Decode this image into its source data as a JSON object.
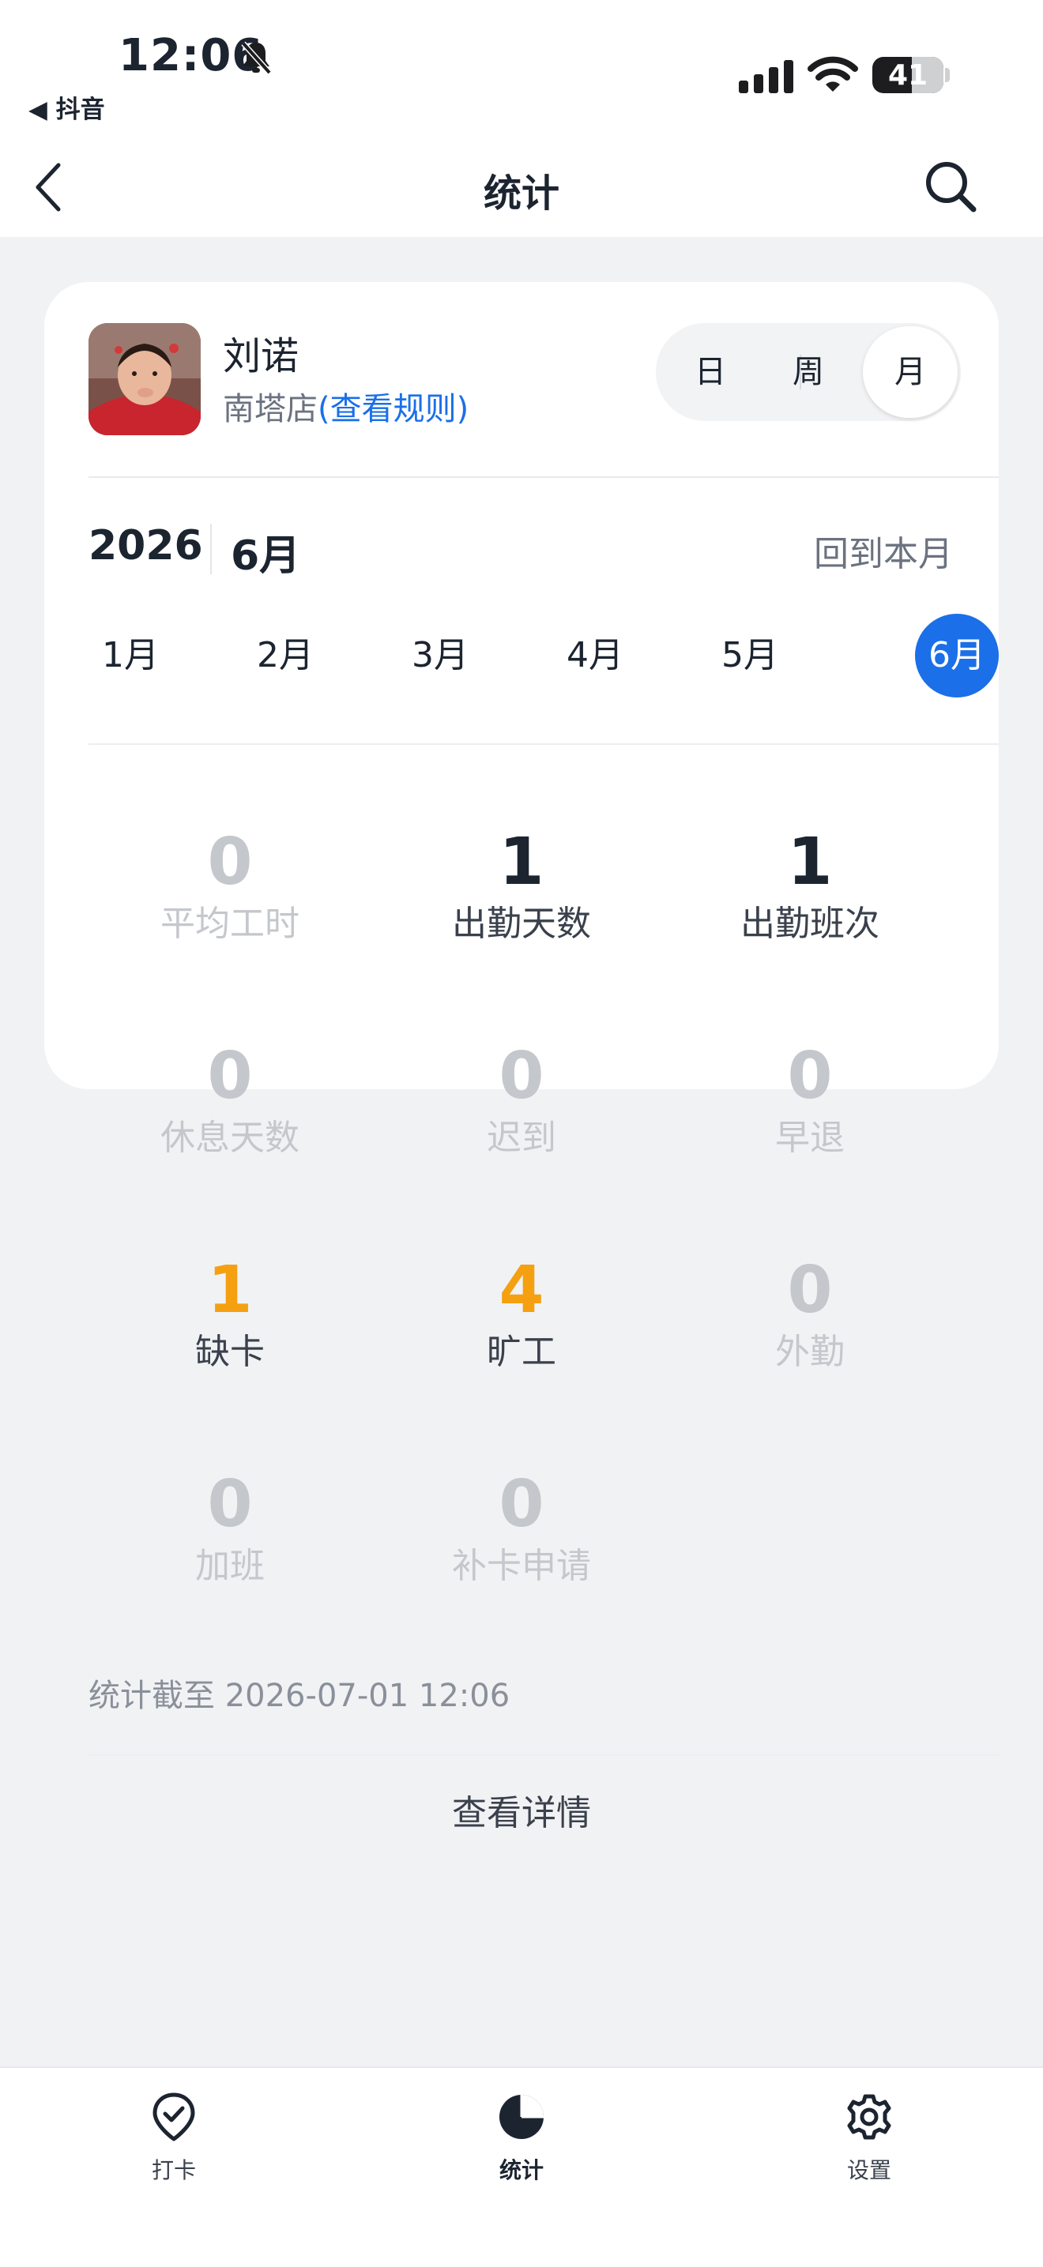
{
  "status_bar": {
    "time": "12:06",
    "back_app": "◀ 抖音",
    "battery": "41"
  },
  "nav": {
    "title": "统计"
  },
  "user": {
    "name": "刘诺",
    "store": "南塔店",
    "rule_link": "(查看规则)"
  },
  "period_toggle": {
    "options": [
      "日",
      "周",
      "月"
    ],
    "selected": "月"
  },
  "month_selector": {
    "year": "2026",
    "current_month": "6月",
    "back_to_current": "回到本月",
    "months": [
      "1月",
      "2月",
      "3月",
      "4月",
      "5月",
      "6月"
    ],
    "selected": "6月"
  },
  "stats": [
    {
      "value": "0",
      "label": "平均工时",
      "tone": "muted"
    },
    {
      "value": "1",
      "label": "出勤天数",
      "tone": "dark"
    },
    {
      "value": "1",
      "label": "出勤班次",
      "tone": "dark"
    },
    {
      "value": "0",
      "label": "休息天数",
      "tone": "muted"
    },
    {
      "value": "0",
      "label": "迟到",
      "tone": "muted"
    },
    {
      "value": "0",
      "label": "早退",
      "tone": "muted"
    },
    {
      "value": "1",
      "label": "缺卡",
      "tone": "warning"
    },
    {
      "value": "4",
      "label": "旷工",
      "tone": "warning"
    },
    {
      "value": "0",
      "label": "外勤",
      "tone": "muted"
    },
    {
      "value": "0",
      "label": "加班",
      "tone": "muted"
    },
    {
      "value": "0",
      "label": "补卡申请",
      "tone": "muted"
    }
  ],
  "cutoff_text": "统计截至 2026-07-01 12:06",
  "details_button": "查看详情",
  "tab_bar": {
    "items": [
      {
        "label": "打卡",
        "icon": "location-check-icon"
      },
      {
        "label": "统计",
        "icon": "pie-chart-icon"
      },
      {
        "label": "设置",
        "icon": "gear-icon"
      }
    ],
    "active": "统计"
  },
  "colors": {
    "accent": "#1b6fe8",
    "warning": "#f5a011",
    "muted": "#c4c7cc",
    "dark": "#1c2430"
  }
}
